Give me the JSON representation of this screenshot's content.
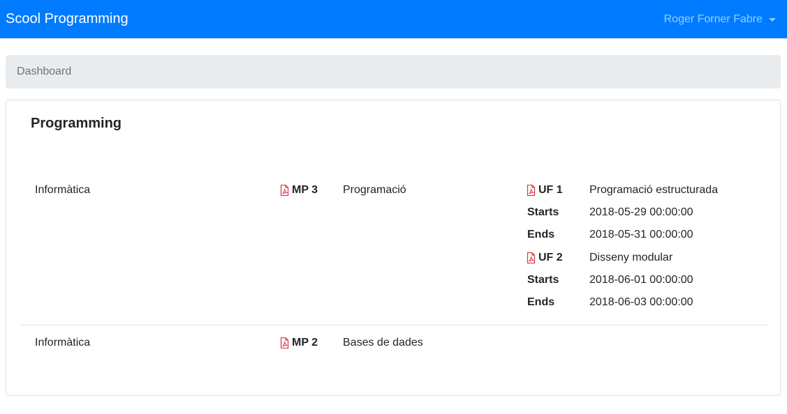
{
  "navbar": {
    "brand": "Scool Programming",
    "user_name": "Roger Forner Fabre"
  },
  "breadcrumb": {
    "label": "Dashboard"
  },
  "card": {
    "title": "Programming",
    "rows": [
      {
        "family": "Informàtica",
        "module_code": "MP 3",
        "module_name": "Programació",
        "units": [
          {
            "code": "UF 1",
            "name": "Programació estructurada",
            "starts_label": "Starts",
            "starts": "2018-05-29 00:00:00",
            "ends_label": "Ends",
            "ends": "2018-05-31 00:00:00"
          },
          {
            "code": "UF 2",
            "name": "Disseny modular",
            "starts_label": "Starts",
            "starts": "2018-06-01 00:00:00",
            "ends_label": "Ends",
            "ends": "2018-06-03 00:00:00"
          }
        ]
      },
      {
        "family": "Informàtica",
        "module_code": "MP 2",
        "module_name": "Bases de dades"
      }
    ]
  },
  "colors": {
    "navbar": "#007bff",
    "pdf_icon": "#dc3545",
    "breadcrumb_bg": "#e9ecef"
  },
  "icons": {
    "pdf": "file-pdf-icon",
    "user_menu": "caret-down-icon"
  }
}
